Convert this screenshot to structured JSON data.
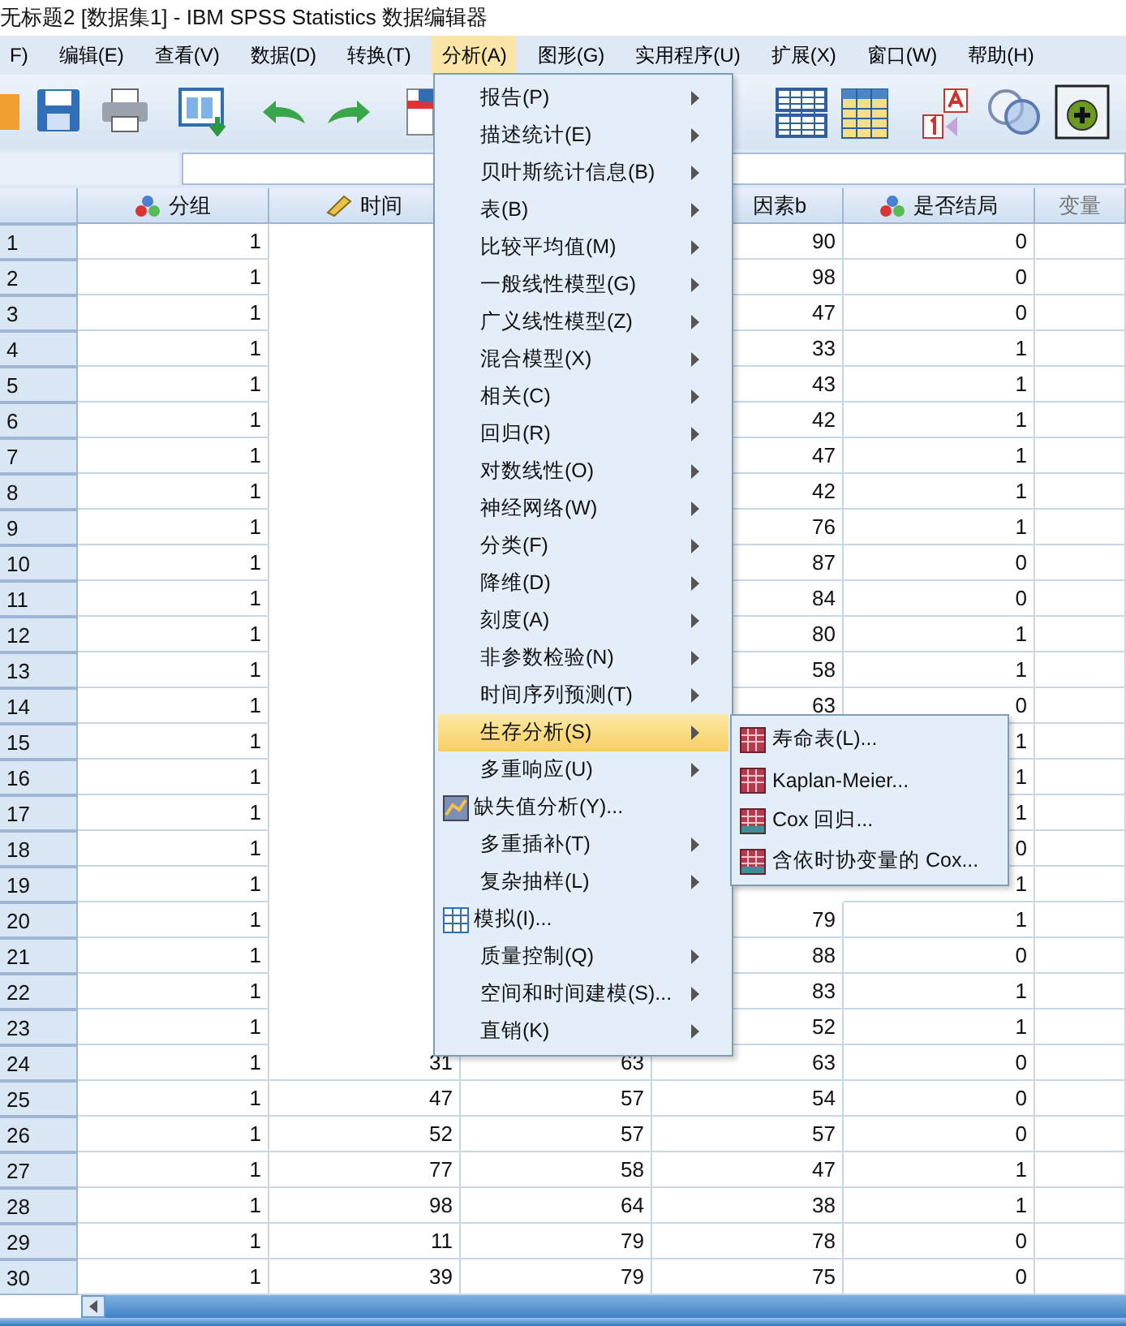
{
  "window": {
    "title": "无标题2 [数据集1] - IBM SPSS Statistics 数据编辑器"
  },
  "menubar": [
    {
      "label": "F)",
      "selected": false
    },
    {
      "label": "编辑(E)",
      "selected": false
    },
    {
      "label": "查看(V)",
      "selected": false
    },
    {
      "label": "数据(D)",
      "selected": false
    },
    {
      "label": "转换(T)",
      "selected": false
    },
    {
      "label": "分析(A)",
      "selected": true
    },
    {
      "label": "图形(G)",
      "selected": false
    },
    {
      "label": "实用程序(U)",
      "selected": false
    },
    {
      "label": "扩展(X)",
      "selected": false
    },
    {
      "label": "窗口(W)",
      "selected": false
    },
    {
      "label": "帮助(H)",
      "selected": false
    }
  ],
  "table": {
    "columns": [
      {
        "label": "分组",
        "kind": "nominal"
      },
      {
        "label": "时间",
        "kind": "scale"
      },
      {
        "kind": "plain"
      },
      {
        "label": "因素b",
        "kind": "plain"
      },
      {
        "label": "是否结局",
        "kind": "nominal"
      },
      {
        "label": "变量",
        "kind": "empty"
      }
    ],
    "rows": [
      {
        "number": "1",
        "cells": [
          "1",
          null,
          null,
          "90",
          "0"
        ]
      },
      {
        "number": "2",
        "cells": [
          "1",
          null,
          null,
          "98",
          "0"
        ]
      },
      {
        "number": "3",
        "cells": [
          "1",
          null,
          null,
          "47",
          "0"
        ]
      },
      {
        "number": "4",
        "cells": [
          "1",
          null,
          null,
          "33",
          "1"
        ]
      },
      {
        "number": "5",
        "cells": [
          "1",
          null,
          null,
          "43",
          "1"
        ]
      },
      {
        "number": "6",
        "cells": [
          "1",
          null,
          null,
          "42",
          "1"
        ]
      },
      {
        "number": "7",
        "cells": [
          "1",
          null,
          null,
          "47",
          "1"
        ]
      },
      {
        "number": "8",
        "cells": [
          "1",
          null,
          null,
          "42",
          "1"
        ]
      },
      {
        "number": "9",
        "cells": [
          "1",
          null,
          null,
          "76",
          "1"
        ]
      },
      {
        "number": "10",
        "cells": [
          "1",
          null,
          null,
          "87",
          "0"
        ]
      },
      {
        "number": "11",
        "cells": [
          "1",
          null,
          null,
          "84",
          "0"
        ]
      },
      {
        "number": "12",
        "cells": [
          "1",
          null,
          null,
          "80",
          "1"
        ]
      },
      {
        "number": "13",
        "cells": [
          "1",
          null,
          null,
          "58",
          "1"
        ]
      },
      {
        "number": "14",
        "cells": [
          "1",
          null,
          null,
          "63",
          "0"
        ]
      },
      {
        "number": "15",
        "cells": [
          "1",
          null,
          null,
          null,
          "1"
        ]
      },
      {
        "number": "16",
        "cells": [
          "1",
          null,
          null,
          null,
          "1"
        ]
      },
      {
        "number": "17",
        "cells": [
          "1",
          null,
          null,
          null,
          "1"
        ]
      },
      {
        "number": "18",
        "cells": [
          "1",
          null,
          null,
          null,
          "0"
        ]
      },
      {
        "number": "19",
        "cells": [
          "1",
          null,
          null,
          null,
          "1"
        ]
      },
      {
        "number": "20",
        "cells": [
          "1",
          null,
          null,
          "79",
          "1"
        ]
      },
      {
        "number": "21",
        "cells": [
          "1",
          null,
          null,
          "88",
          "0"
        ]
      },
      {
        "number": "22",
        "cells": [
          "1",
          null,
          null,
          "83",
          "1"
        ]
      },
      {
        "number": "23",
        "cells": [
          "1",
          null,
          null,
          "52",
          "1"
        ]
      },
      {
        "number": "24",
        "cells": [
          "1",
          "31",
          "63",
          "63",
          "0"
        ]
      },
      {
        "number": "25",
        "cells": [
          "1",
          "47",
          "57",
          "54",
          "0"
        ]
      },
      {
        "number": "26",
        "cells": [
          "1",
          "52",
          "57",
          "57",
          "0"
        ]
      },
      {
        "number": "27",
        "cells": [
          "1",
          "77",
          "58",
          "47",
          "1"
        ]
      },
      {
        "number": "28",
        "cells": [
          "1",
          "98",
          "64",
          "38",
          "1"
        ]
      },
      {
        "number": "29",
        "cells": [
          "1",
          "11",
          "79",
          "78",
          "0"
        ]
      },
      {
        "number": "30",
        "cells": [
          "1",
          "39",
          "79",
          "75",
          "0"
        ]
      }
    ]
  },
  "analysis_menu": [
    {
      "label": "报告(P)",
      "kind": "submenu",
      "selected": false
    },
    {
      "label": "描述统计(E)",
      "kind": "submenu",
      "selected": false
    },
    {
      "label": "贝叶斯统计信息(B)",
      "kind": "submenu",
      "selected": false
    },
    {
      "label": "表(B)",
      "kind": "submenu",
      "selected": false
    },
    {
      "label": "比较平均值(M)",
      "kind": "submenu",
      "selected": false
    },
    {
      "label": "一般线性模型(G)",
      "kind": "submenu",
      "selected": false
    },
    {
      "label": "广义线性模型(Z)",
      "kind": "submenu",
      "selected": false
    },
    {
      "label": "混合模型(X)",
      "kind": "submenu",
      "selected": false
    },
    {
      "label": "相关(C)",
      "kind": "submenu",
      "selected": false
    },
    {
      "label": "回归(R)",
      "kind": "submenu",
      "selected": false
    },
    {
      "label": "对数线性(O)",
      "kind": "submenu",
      "selected": false
    },
    {
      "label": "神经网络(W)",
      "kind": "submenu",
      "selected": false
    },
    {
      "label": "分类(F)",
      "kind": "submenu",
      "selected": false
    },
    {
      "label": "降维(D)",
      "kind": "submenu",
      "selected": false
    },
    {
      "label": "刻度(A)",
      "kind": "submenu",
      "selected": false
    },
    {
      "label": "非参数检验(N)",
      "kind": "submenu",
      "selected": false
    },
    {
      "label": "时间序列预测(T)",
      "kind": "submenu",
      "selected": false
    },
    {
      "label": "生存分析(S)",
      "kind": "submenu",
      "selected": true
    },
    {
      "label": "多重响应(U)",
      "kind": "submenu",
      "selected": false
    },
    {
      "label": "缺失值分析(Y)...",
      "kind": "chart-dialog",
      "selected": false
    },
    {
      "label": "多重插补(T)",
      "kind": "submenu",
      "selected": false
    },
    {
      "label": "复杂抽样(L)",
      "kind": "submenu",
      "selected": false
    },
    {
      "label": "模拟(I)...",
      "kind": "grid-dialog",
      "selected": false
    },
    {
      "label": "质量控制(Q)",
      "kind": "submenu",
      "selected": false
    },
    {
      "label": "空间和时间建模(S)...",
      "kind": "submenu",
      "selected": false
    },
    {
      "label": "直销(K)",
      "kind": "submenu",
      "selected": false
    }
  ],
  "survival_submenu": [
    {
      "label": "寿命表(L)...",
      "kind": "table",
      "selected": false
    },
    {
      "label": "Kaplan-Meier...",
      "kind": "table",
      "selected": false
    },
    {
      "label": "Cox 回归...",
      "kind": "cox",
      "selected": false
    },
    {
      "label": "含依时协变量的 Cox...",
      "kind": "cox",
      "selected": false
    }
  ]
}
